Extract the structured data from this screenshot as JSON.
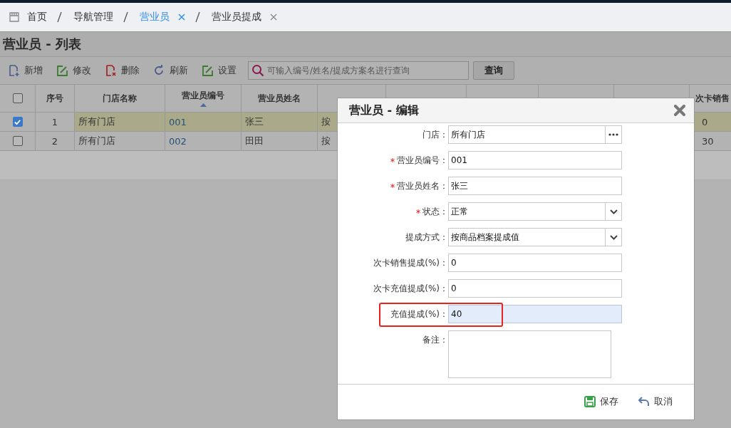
{
  "breadcrumbs": [
    {
      "label": "首页",
      "kind": "home",
      "selected": false,
      "closable": false
    },
    {
      "label": "导航管理",
      "kind": "link",
      "selected": false,
      "closable": false
    },
    {
      "label": "营业员",
      "kind": "tab",
      "selected": true,
      "closable": true
    },
    {
      "label": "营业员提成",
      "kind": "tab",
      "selected": false,
      "closable": true
    }
  ],
  "page_title": "营业员 - 列表",
  "toolbar": {
    "buttons": [
      {
        "label": "新增",
        "kind": "add"
      },
      {
        "label": "修改",
        "kind": "edit"
      },
      {
        "label": "删除",
        "kind": "delete"
      },
      {
        "label": "刷新",
        "kind": "refresh"
      },
      {
        "label": "设置",
        "kind": "settings"
      }
    ],
    "search": {
      "placeholder": "可输入编号/姓名/提成方案名进行查询"
    },
    "search_button": "查询"
  },
  "table": {
    "all_checked": false,
    "columns": [
      {
        "label": "序号",
        "sorted": false
      },
      {
        "label": "门店名称",
        "sorted": false
      },
      {
        "label": "营业员编号",
        "sorted": true
      },
      {
        "label": "营业员姓名",
        "sorted": false
      },
      {},
      {},
      {},
      {},
      {},
      {
        "label": "次卡销售",
        "sorted": false
      }
    ],
    "rows": [
      {
        "selected": true,
        "checked": true,
        "cells": [
          "1",
          "所有门店",
          "001",
          "张三",
          "按",
          null,
          null,
          null,
          null,
          "0"
        ]
      },
      {
        "selected": false,
        "checked": false,
        "cells": [
          "2",
          "所有门店",
          "002",
          "田田",
          "按",
          null,
          null,
          null,
          null,
          "30"
        ]
      }
    ]
  },
  "dialog": {
    "title": "营业员 - 编辑",
    "fields": [
      {
        "label": "门店：",
        "kind": "picker",
        "required": false,
        "value": "所有门店",
        "focused": false,
        "highlighted": false
      },
      {
        "label": "营业员编号：",
        "kind": "text",
        "required": true,
        "value": "001",
        "focused": false,
        "highlighted": false
      },
      {
        "label": "营业员姓名：",
        "kind": "text",
        "required": true,
        "value": "张三",
        "focused": false,
        "highlighted": false
      },
      {
        "label": "状态：",
        "kind": "select",
        "required": true,
        "value": "正常",
        "focused": false,
        "highlighted": false
      },
      {
        "label": "提成方式：",
        "kind": "select",
        "required": false,
        "value": "按商品档案提成值",
        "focused": false,
        "highlighted": false
      },
      {
        "label": "次卡销售提成(%)：",
        "kind": "text",
        "required": false,
        "value": "0",
        "focused": false,
        "highlighted": false
      },
      {
        "label": "次卡充值提成(%)：",
        "kind": "text",
        "required": false,
        "value": "0",
        "focused": false,
        "highlighted": false
      },
      {
        "label": "充值提成(%)：",
        "kind": "text",
        "required": false,
        "value": "40",
        "focused": true,
        "highlighted": true
      },
      {
        "label": "备注：",
        "kind": "textarea",
        "required": false,
        "focused": false,
        "highlighted": false
      }
    ],
    "buttons": [
      {
        "label": "保存",
        "kind": "save"
      },
      {
        "label": "取消",
        "kind": "cancel"
      }
    ]
  }
}
